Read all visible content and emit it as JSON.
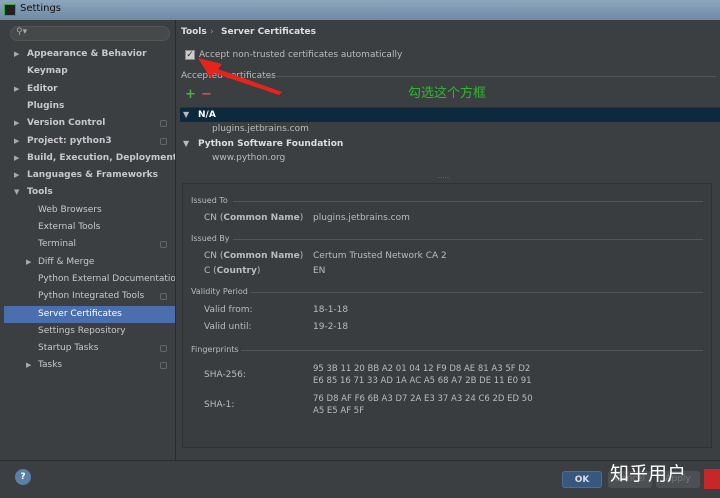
{
  "window": {
    "title": "Settings"
  },
  "sidebar": {
    "search_placeholder": "",
    "items": [
      {
        "label": "Appearance & Behavior"
      },
      {
        "label": "Keymap"
      },
      {
        "label": "Editor"
      },
      {
        "label": "Plugins"
      },
      {
        "label": "Version Control"
      },
      {
        "label": "Project: python3"
      },
      {
        "label": "Build, Execution, Deployment"
      },
      {
        "label": "Languages & Frameworks"
      },
      {
        "label": "Tools"
      },
      {
        "label": "Web Browsers"
      },
      {
        "label": "External Tools"
      },
      {
        "label": "Terminal"
      },
      {
        "label": "Diff & Merge"
      },
      {
        "label": "Python External Documentation"
      },
      {
        "label": "Python Integrated Tools"
      },
      {
        "label": "Server Certificates"
      },
      {
        "label": "Settings Repository"
      },
      {
        "label": "Startup Tasks"
      },
      {
        "label": "Tasks"
      }
    ]
  },
  "breadcrumb": {
    "parent": "Tools",
    "sep": "›",
    "current": "Server Certificates"
  },
  "accept_checkbox": {
    "label": "Accept non-trusted certificates automatically",
    "checked": true
  },
  "accepted_label": "Accepted certificates",
  "toolbar": {
    "add": "+",
    "remove": "−"
  },
  "tree": [
    {
      "group": "N/A",
      "children": [
        "plugins.jetbrains.com"
      ]
    },
    {
      "group": "Python Software Foundation",
      "children": [
        "www.python.org"
      ]
    }
  ],
  "details": {
    "issued_to": {
      "heading": "Issued To",
      "cn_label": "CN (",
      "cn_bold": "Common Name",
      "close": ")",
      "cn_value": "plugins.jetbrains.com"
    },
    "issued_by": {
      "heading": "Issued By",
      "cn_label": "CN (",
      "cn_bold": "Common Name",
      "close": ")",
      "cn_value": "Certum Trusted Network CA 2",
      "c_label": "C (",
      "c_bold": "Country",
      "c_value": "EN"
    },
    "validity": {
      "heading": "Validity Period",
      "from_label": "Valid from:",
      "from_value": "18-1-18",
      "until_label": "Valid until:",
      "until_value": "19-2-18"
    },
    "fingerprints": {
      "heading": "Fingerprints",
      "sha256_label": "SHA-256:",
      "sha256_line1": "95 3B 11 20 BB A2 01 04 12 F9 D8 AE 81 A3 5F D2",
      "sha256_line2": "E6 85 16 71 33 AD 1A AC A5 68 A7 2B DE 11 E0 91",
      "sha1_label": "SHA-1:",
      "sha1_line1": "76 D8 AF F6 6B A3 D7 2A E3 37 A3 24 C6 2D ED 50",
      "sha1_line2": "A5 E5 AF 5F"
    }
  },
  "annotation": {
    "text": "勾选这个方框",
    "color": "#2fb82f",
    "arrow_color": "#e8231c"
  },
  "buttons": {
    "help": "?",
    "ok": "OK",
    "cancel": "Cancel",
    "apply": "Apply"
  },
  "watermark": "知乎用户"
}
